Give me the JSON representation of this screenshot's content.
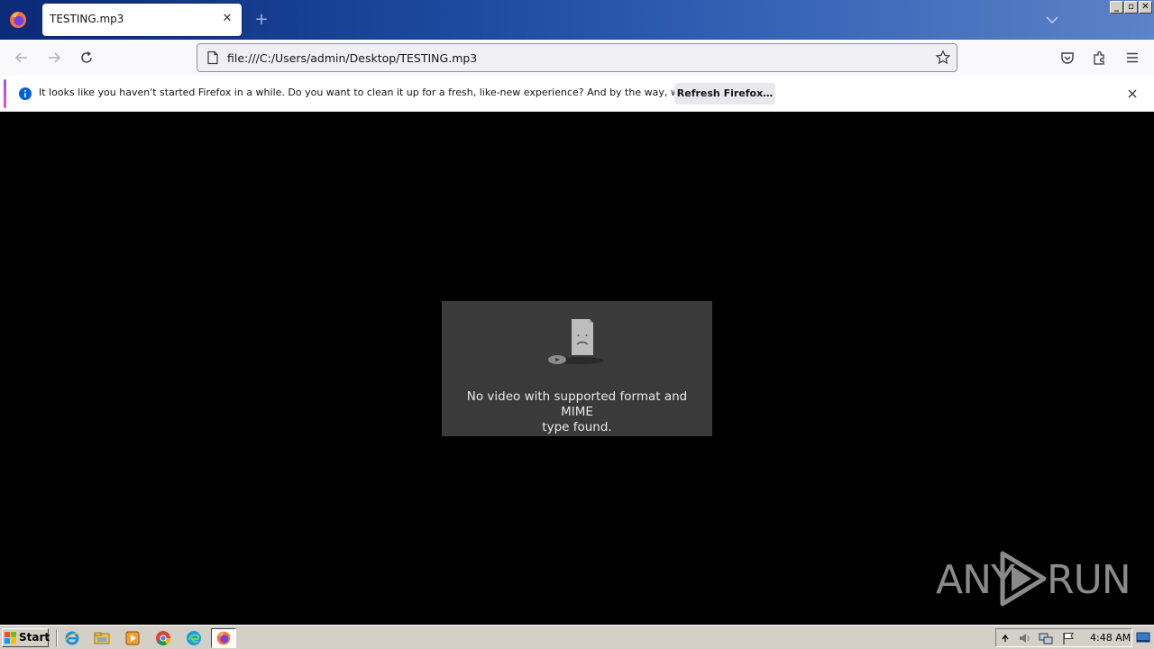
{
  "browser": {
    "tab": {
      "title": "TESTING.mp3"
    },
    "url": "file:///C:/Users/admin/Desktop/TESTING.mp3"
  },
  "notification": {
    "message": "It looks like you haven't started Firefox in a while. Do you want to clean it up for a fresh, like-new experience? And by the way, welcome back!",
    "button_label": "Refresh Firefox…"
  },
  "media_error": {
    "line1": "No video with supported format and MIME",
    "line2": "type found."
  },
  "watermark": {
    "left": "ANY",
    "right": "RUN"
  },
  "taskbar": {
    "start_label": "Start",
    "clock": "4:48 AM"
  },
  "colors": {
    "titlebar_start": "#0b2a78",
    "titlebar_end": "#5d83c8",
    "content_bg": "#000000",
    "error_box_bg": "#3a3a3a",
    "info_blue": "#0060df",
    "taskbar_bg": "#d4d0c8"
  },
  "icons": {
    "firefox_menu": "firefox-icon",
    "tab_close": "close-icon",
    "new_tab": "plus-icon",
    "tab_list": "chevron-down-icon",
    "back": "arrow-left-icon",
    "forward": "arrow-right-icon",
    "reload": "reload-icon",
    "page": "page-icon",
    "bookmark": "star-icon",
    "pocket": "pocket-icon",
    "extensions": "puzzle-icon",
    "menu": "hamburger-icon",
    "info": "info-icon",
    "notice_close": "close-icon"
  }
}
